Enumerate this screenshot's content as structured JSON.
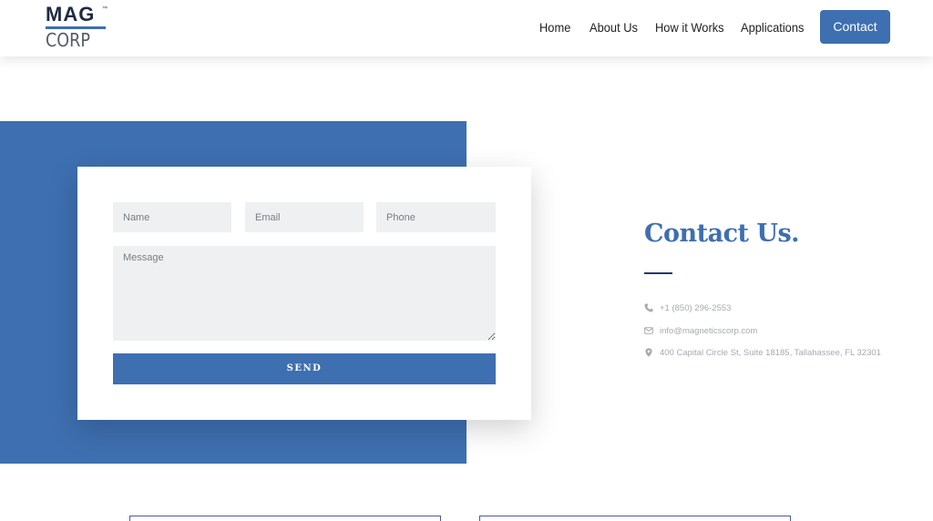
{
  "logo": {
    "top": "MAG",
    "tm": "™",
    "bottom": "CORP"
  },
  "nav": {
    "items": [
      "Home",
      "About Us",
      "How it Works",
      "Applications"
    ],
    "cta": "Contact"
  },
  "form": {
    "name_placeholder": "Name",
    "email_placeholder": "Email",
    "phone_placeholder": "Phone",
    "message_placeholder": "Message",
    "send_label": "SEND"
  },
  "contact": {
    "title": "Contact Us.",
    "phone": "+1 (850) 296-2553",
    "email": "info@magneticscorp.com",
    "address": "400 Capital Circle St, Suite 18185, Tallahassee, FL 32301"
  },
  "icons": [
    "phone-icon",
    "envelope-icon",
    "map-pin-icon"
  ],
  "colors": {
    "brand_blue": "#3e6fb0",
    "dark_navy": "#1f3a6e",
    "input_bg": "#eff0f2",
    "muted_text": "#a7aab0"
  }
}
